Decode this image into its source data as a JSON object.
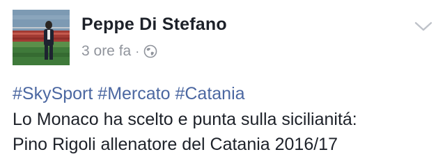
{
  "post": {
    "author": "Peppe Di Stefano",
    "time": "3 ore fa",
    "separator": "·",
    "privacy_icon": "globe-icon",
    "menu_icon": "chevron-down-icon",
    "hashtags": [
      "#SkySport",
      "#Mercato",
      "#Catania"
    ],
    "body_lines": [
      "Lo Monaco ha scelto e punta sulla sicilianitá:",
      "Pino Rigoli allenatore del Catania 2016/17"
    ]
  },
  "colors": {
    "author": "#1d2129",
    "meta": "#90949c",
    "hashtag": "#4b67a1",
    "body": "#1d2129"
  }
}
